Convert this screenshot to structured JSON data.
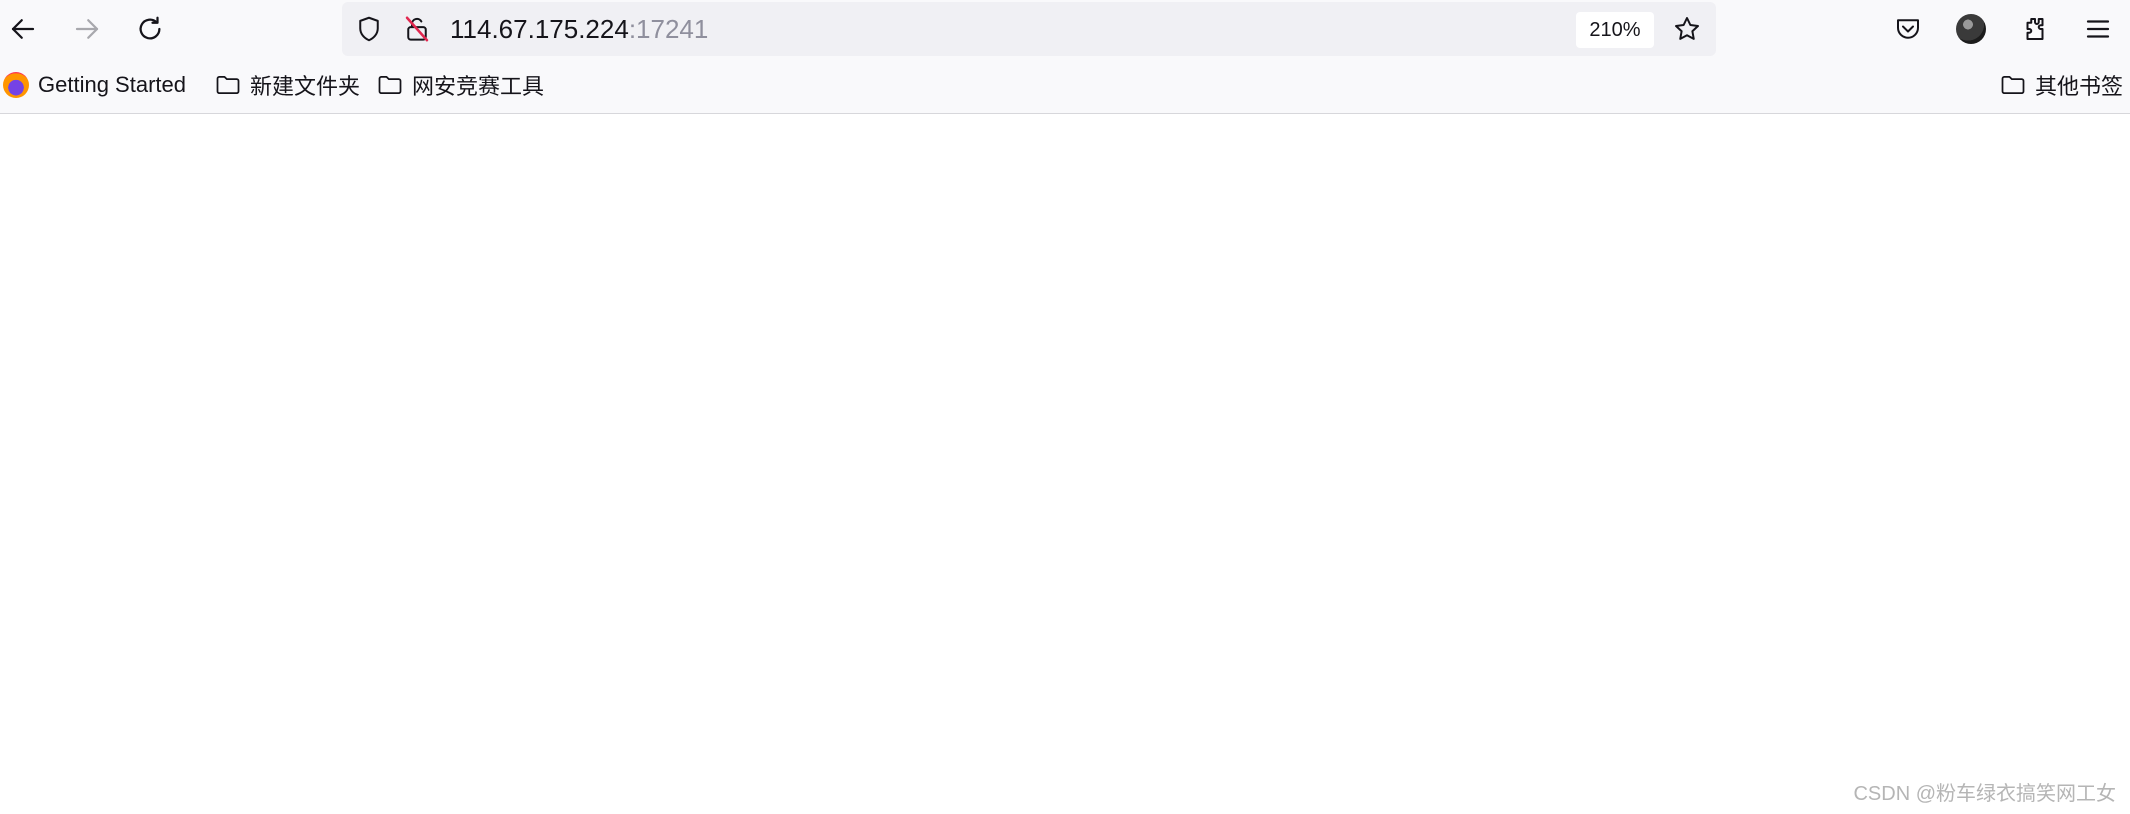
{
  "toolbar": {
    "back_icon": "arrow-left-icon",
    "forward_icon": "arrow-right-icon",
    "reload_icon": "reload-icon"
  },
  "urlbar": {
    "host": "114.67.175.224",
    "port": ":17241",
    "zoom": "210%",
    "icons": [
      "shield-icon",
      "insecure-lock-icon",
      "star-icon"
    ]
  },
  "right_toolbar": {
    "icons": [
      "pocket-icon",
      "account-avatar",
      "extensions-icon",
      "menu-icon"
    ]
  },
  "bookmarks": {
    "items": [
      {
        "label": "Getting Started",
        "icon": "firefox-icon"
      },
      {
        "label": "新建文件夹",
        "icon": "folder-icon"
      },
      {
        "label": "网安竞赛工具",
        "icon": "folder-icon"
      }
    ],
    "other": {
      "label": "其他书签",
      "icon": "folder-icon"
    }
  },
  "watermark": "CSDN @粉车绿衣搞笑网工女",
  "colors": {
    "toolbar_bg": "#f9f9fb",
    "urlbar_bg": "#f0f0f4",
    "text": "#15141a",
    "port_text": "#8f8f9d",
    "insecure_red": "#e22850"
  }
}
